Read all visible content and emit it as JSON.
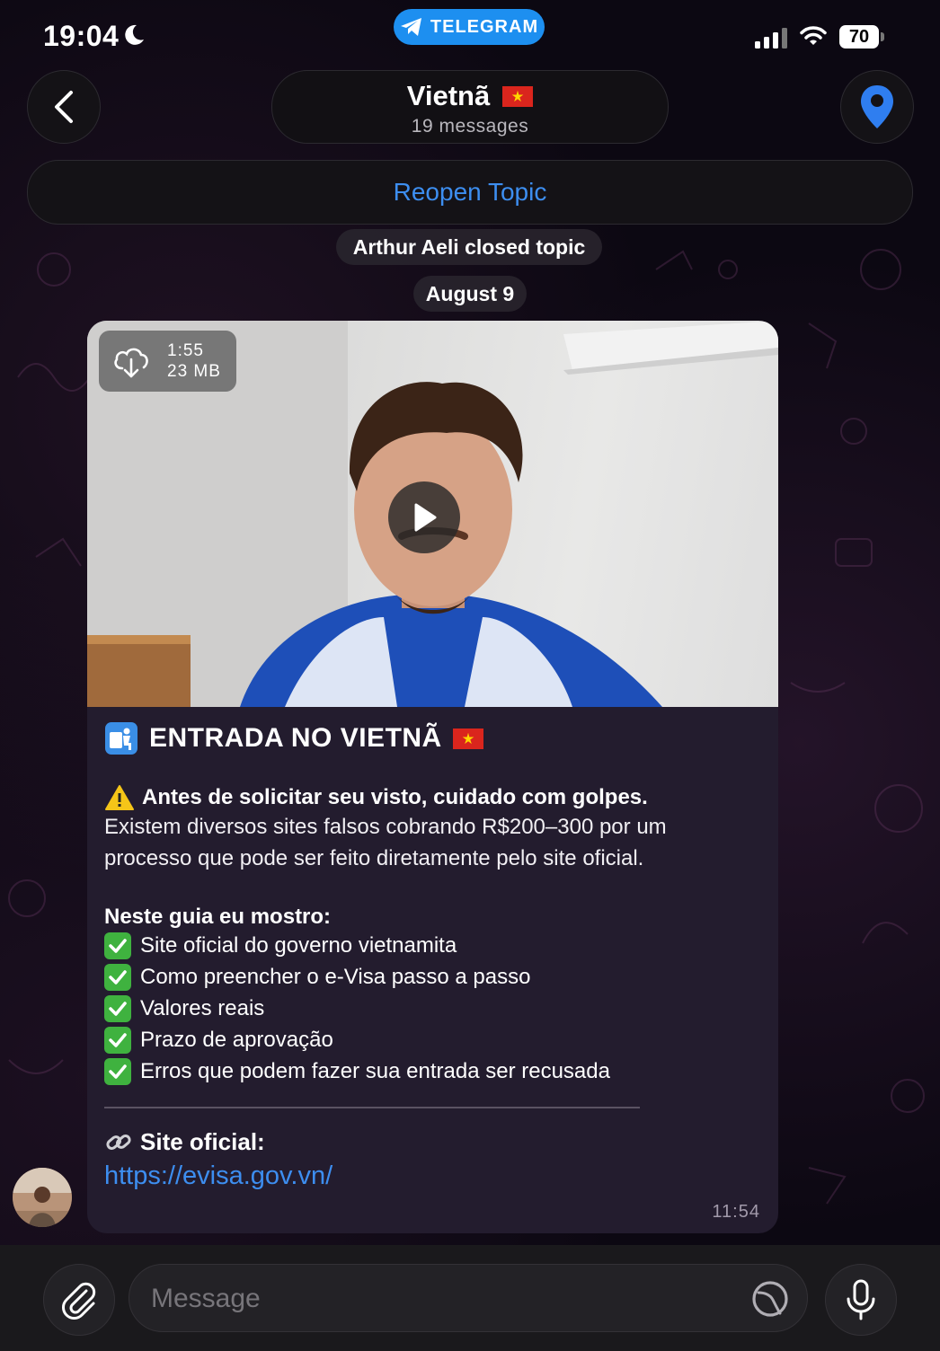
{
  "status_bar": {
    "time": "19:04",
    "app_pill": "TELEGRAM",
    "battery": "70"
  },
  "header": {
    "title": "Vietnã",
    "subtitle": "19 messages"
  },
  "reopen_label": "Reopen Topic",
  "service_messages": {
    "closed": "Arthur Aeli closed topic",
    "date": "August 9"
  },
  "message": {
    "video": {
      "duration": "1:55",
      "size": "23 MB"
    },
    "title": "ENTRADA NO VIETNÃ",
    "warning": "Antes de solicitar seu visto, cuidado com golpes.",
    "paragraph_1": "Existem diversos sites falsos cobrando R$200–300 por um",
    "paragraph_2": "processo que pode ser feito diretamente pelo site oficial.",
    "guide_heading": "Neste guia eu mostro:",
    "checklist": [
      "Site oficial do governo vietnamita",
      "Como preencher o e-Visa passo a passo",
      "Valores reais",
      "Prazo de aprovação",
      "Erros que podem fazer sua entrada ser recusada"
    ],
    "site_label": "Site oficial:",
    "site_link": "https://evisa.gov.vn/",
    "time": "11:54"
  },
  "input": {
    "placeholder": "Message"
  },
  "colors": {
    "accent": "#3d8ef0",
    "telegram_pill": "#1d8ff0",
    "bubble": "#231c2e",
    "flag_red": "#da251d",
    "flag_star": "#ffd700"
  }
}
